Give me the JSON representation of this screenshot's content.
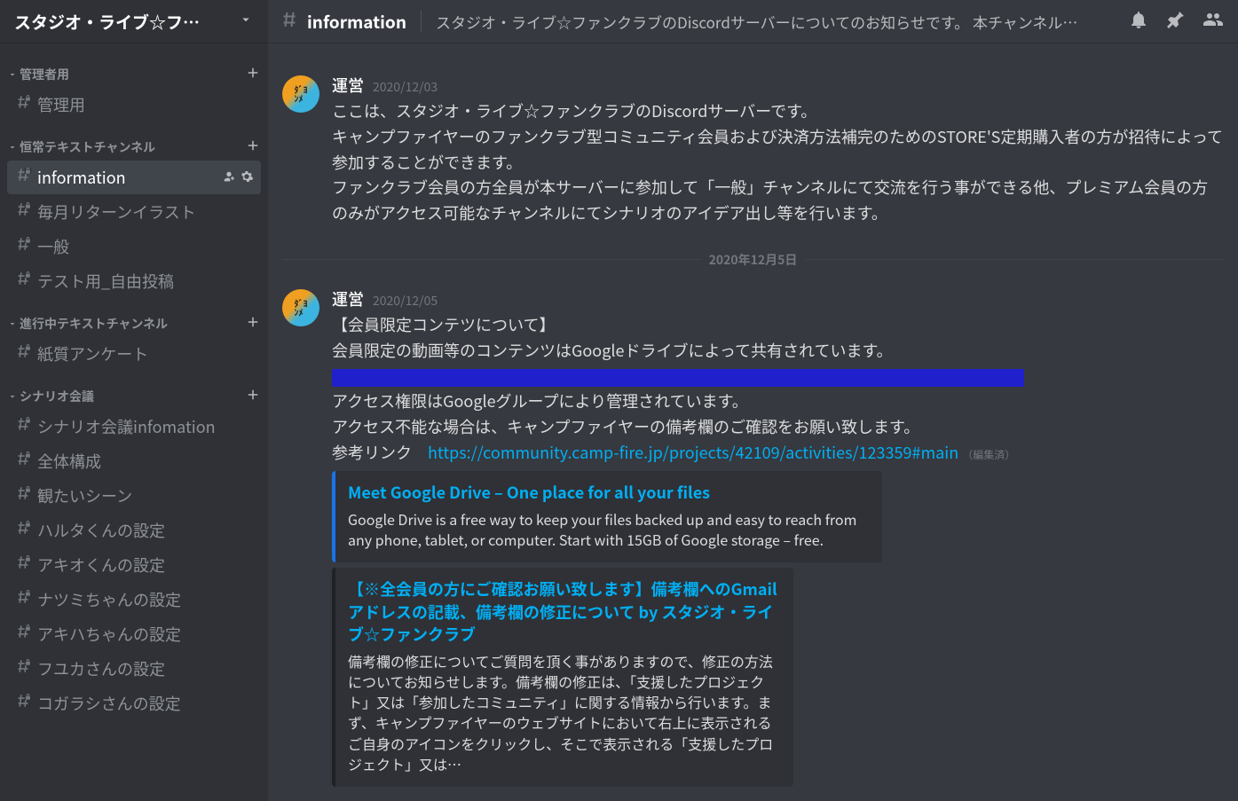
{
  "server": {
    "name": "スタジオ・ライブ☆フ…"
  },
  "categories": [
    {
      "name": "管理者用",
      "channels": [
        {
          "name": "管理用",
          "locked": true,
          "active": false
        }
      ]
    },
    {
      "name": "恒常テキストチャンネル",
      "channels": [
        {
          "name": "information",
          "locked": true,
          "active": true
        },
        {
          "name": "毎月リターンイラスト",
          "locked": true,
          "active": false
        },
        {
          "name": "一般",
          "locked": true,
          "active": false
        },
        {
          "name": "テスト用_自由投稿",
          "locked": true,
          "active": false
        }
      ]
    },
    {
      "name": "進行中テキストチャンネル",
      "channels": [
        {
          "name": "紙質アンケート",
          "locked": true,
          "active": false
        }
      ]
    },
    {
      "name": "シナリオ会議",
      "channels": [
        {
          "name": "シナリオ会議infomation",
          "locked": true,
          "active": false
        },
        {
          "name": "全体構成",
          "locked": true,
          "active": false
        },
        {
          "name": "観たいシーン",
          "locked": true,
          "active": false
        },
        {
          "name": "ハルタくんの設定",
          "locked": true,
          "active": false
        },
        {
          "name": "アキオくんの設定",
          "locked": true,
          "active": false
        },
        {
          "name": "ナツミちゃんの設定",
          "locked": true,
          "active": false
        },
        {
          "name": "アキハちゃんの設定",
          "locked": true,
          "active": false
        },
        {
          "name": "フユカさんの設定",
          "locked": true,
          "active": false
        },
        {
          "name": "コガラシさんの設定",
          "locked": true,
          "active": false
        }
      ]
    }
  ],
  "topbar": {
    "channel": "information",
    "topic": "スタジオ・ライブ☆ファンクラブのDiscordサーバーについてのお知らせです。 本チャンネル…"
  },
  "messages": [
    {
      "author": "運営",
      "timestamp": "2020/12/03",
      "lines": [
        "ここは、スタジオ・ライブ☆ファンクラブのDiscordサーバーです。",
        "キャンプファイヤーのファンクラブ型コミュニティ会員および決済方法補完のためのSTORE'S定期購入者の方が招待によって参加することができます。",
        "ファンクラブ会員の方全員が本サーバーに参加して「一般」チャンネルにて交流を行う事ができる他、プレミアム会員の方のみがアクセス可能なチャンネルにてシナリオのアイデア出し等を行います。"
      ]
    }
  ],
  "divider": "2020年12月5日",
  "msg2": {
    "author": "運営",
    "timestamp": "2020/12/05",
    "line1": "【会員限定コンテツについて】",
    "line2": "会員限定の動画等のコンテンツはGoogleドライブによって共有されています。",
    "line3": "アクセス権限はGoogleグループにより管理されています。",
    "line4": "アクセス不能な場合は、キャンプファイヤーの備考欄のご確認をお願い致します。",
    "ref_label": "参考リンク　",
    "ref_url": "https://community.camp-fire.jp/projects/42109/activities/123359#main",
    "edited": "（編集済）"
  },
  "embed1": {
    "title": "Meet Google Drive – One place for all your files",
    "desc": "Google Drive is a free way to keep your files backed up and easy to reach from any phone, tablet, or computer. Start with 15GB of Google storage – free."
  },
  "embed2": {
    "title": "【※全会員の方にご確認お願い致します】備考欄へのGmailアドレスの記載、備考欄の修正について by スタジオ・ライブ☆ファンクラブ",
    "desc": "備考欄の修正についてご質問を頂く事がありますので、修正の方法についてお知らせします。備考欄の修正は、「支援したプロジェクト」又は「参加したコミュニティ」に関する情報から行います。まず、キャンプファイヤーのウェブサイトにおいて右上に表示されるご自身のアイコンをクリックし、そこで表示される「支援したプロジェクト」又は…"
  }
}
